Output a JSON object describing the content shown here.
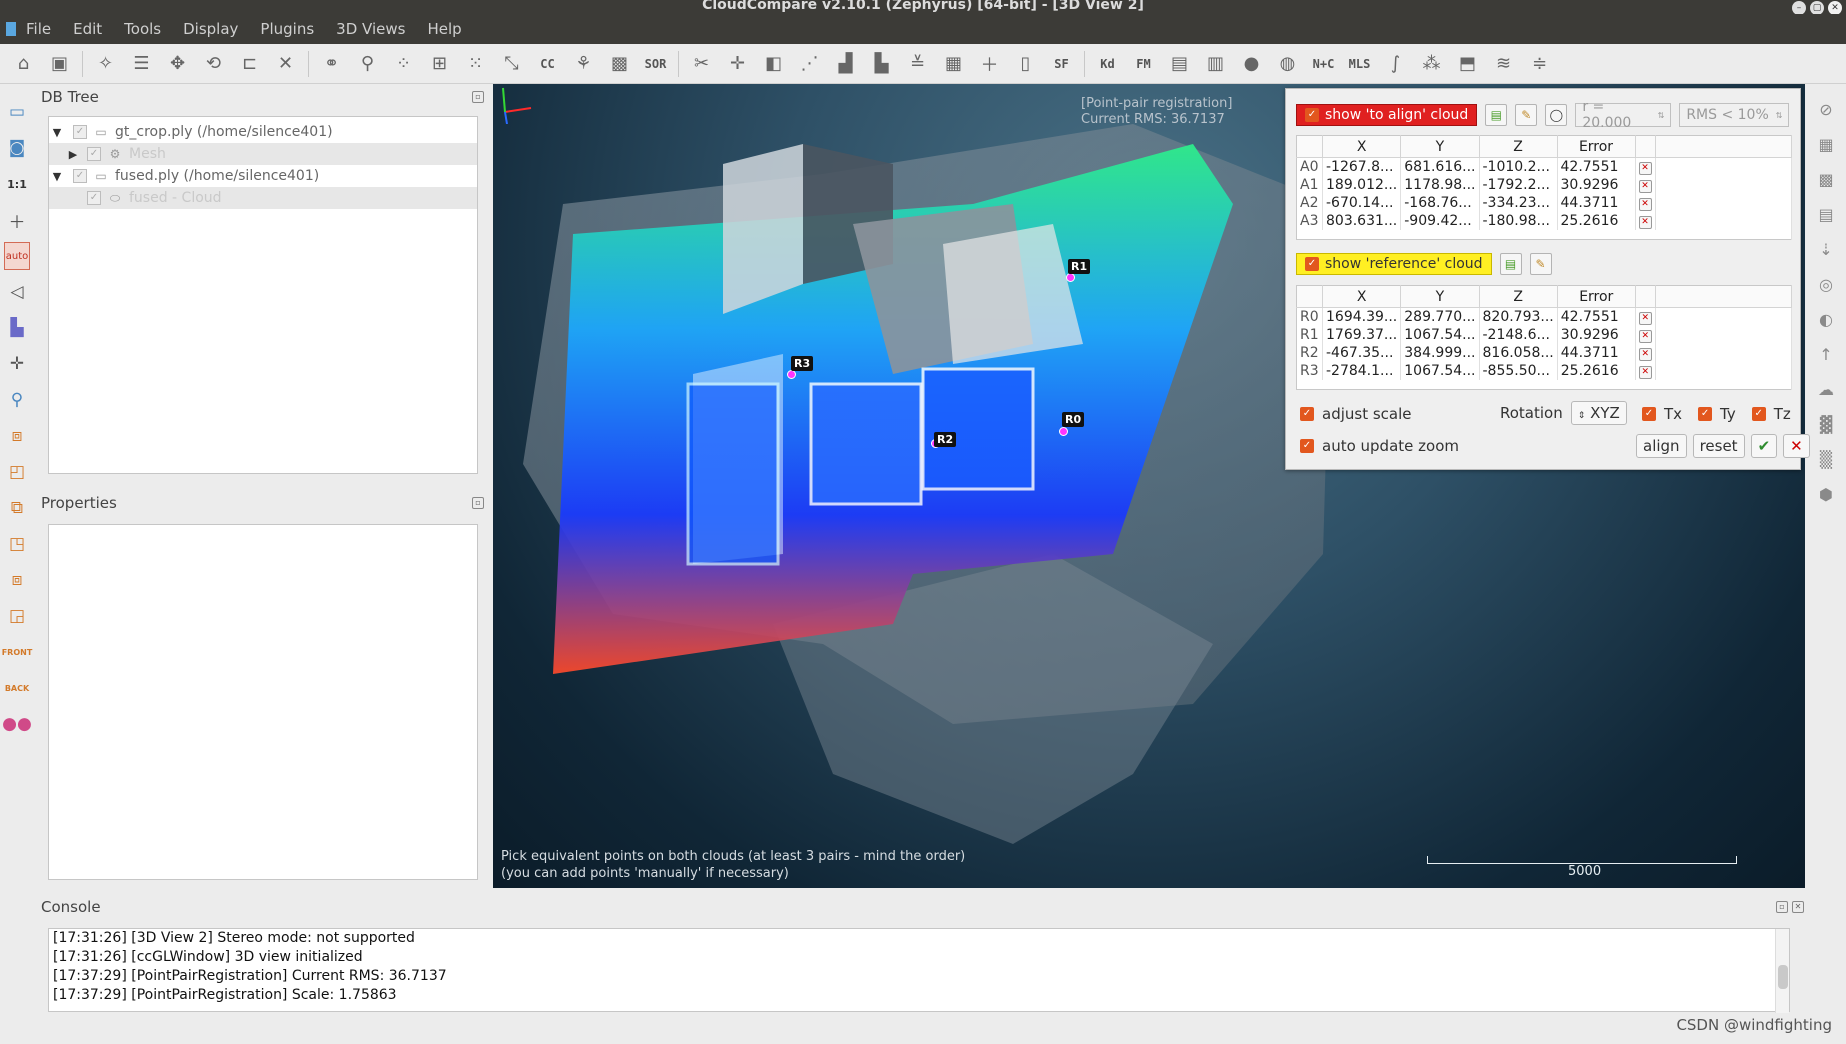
{
  "window": {
    "title": "CloudCompare v2.10.1 (Zephyrus) [64-bit] - [3D View 2]"
  },
  "menu": [
    "File",
    "Edit",
    "Tools",
    "Display",
    "Plugins",
    "3D Views",
    "Help"
  ],
  "toolbar": {
    "sf_label": "SF",
    "sor_label": "SOR",
    "kd_label": "Kd",
    "fm_label": "FM",
    "nc_label": "N+C",
    "mls_label": "MLS",
    "cc_label": "CC"
  },
  "left_toolbar": {
    "scale_label": "1:1",
    "auto_label": "auto",
    "front_label": "FRONT",
    "back_label": "BACK"
  },
  "db_tree": {
    "title": "DB Tree",
    "items": [
      {
        "label": "gt_crop.ply (/home/silence401)",
        "level": 0
      },
      {
        "label": "Mesh",
        "level": 1
      },
      {
        "label": "fused.ply (/home/silence401)",
        "level": 0
      },
      {
        "label": "fused - Cloud",
        "level": 1
      }
    ]
  },
  "properties": {
    "title": "Properties"
  },
  "view": {
    "overlay_title": "[Point-pair registration]",
    "rms_label": "Current RMS: 36.7137",
    "hint_line1": "Pick equivalent points on both clouds (at least 3 pairs - mind the order)",
    "hint_line2": "(you can add points 'manually' if necessary)",
    "scale_value": "5000",
    "markers": [
      "R1",
      "R3",
      "R2",
      "R0"
    ]
  },
  "registration": {
    "align_toggle": "show 'to align' cloud",
    "radius": "r = 20.000",
    "rms_filter": "RMS < 10%",
    "reference_toggle": "show 'reference' cloud",
    "columns": [
      "X",
      "Y",
      "Z",
      "Error"
    ],
    "align_rows": [
      {
        "id": "A0",
        "x": "-1267.8...",
        "y": "681.616...",
        "z": "-1010.2...",
        "error": "42.7551"
      },
      {
        "id": "A1",
        "x": "189.012...",
        "y": "1178.98...",
        "z": "-1792.2...",
        "error": "30.9296"
      },
      {
        "id": "A2",
        "x": "-670.14...",
        "y": "-168.76...",
        "z": "-334.23...",
        "error": "44.3711"
      },
      {
        "id": "A3",
        "x": "803.631...",
        "y": "-909.42...",
        "z": "-180.98...",
        "error": "25.2616"
      }
    ],
    "reference_rows": [
      {
        "id": "R0",
        "x": "1694.39...",
        "y": "289.770...",
        "z": "820.793...",
        "error": "42.7551"
      },
      {
        "id": "R1",
        "x": "1769.37...",
        "y": "1067.54...",
        "z": "-2148.6...",
        "error": "30.9296"
      },
      {
        "id": "R2",
        "x": "-467.35...",
        "y": "384.999...",
        "z": "816.058...",
        "error": "44.3711"
      },
      {
        "id": "R3",
        "x": "-2784.1...",
        "y": "1067.54...",
        "z": "-855.50...",
        "error": "25.2616"
      }
    ],
    "adjust_scale": "adjust scale",
    "rotation_label": "Rotation",
    "rotation_value": "XYZ",
    "tx": "Tx",
    "ty": "Ty",
    "tz": "Tz",
    "auto_update_zoom": "auto update zoom",
    "align_button": "align",
    "reset_button": "reset"
  },
  "console": {
    "title": "Console",
    "lines": [
      "[17:31:26] [3D View 2] Stereo mode: not supported",
      "[17:31:26] [ccGLWindow] 3D view initialized",
      "[17:37:29] [PointPairRegistration] Current RMS: 36.7137",
      "[17:37:29] [PointPairRegistration] Scale: 1.75863"
    ]
  },
  "watermark": "CSDN @windfighting",
  "colors": {
    "align_toggle": "#e02020",
    "reference_toggle": "#ffef23",
    "marker": "#ff35ff",
    "checkbox": "#e2571e"
  }
}
